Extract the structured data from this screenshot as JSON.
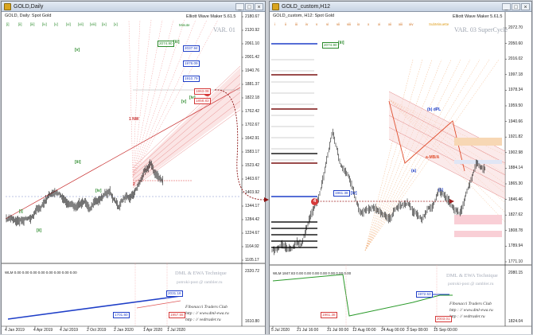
{
  "left": {
    "title": "GOLD,Daily",
    "symbol_line": "GOLD, Daily:  Spot Gold",
    "ewm": "Elliott Wave Maker 5.61.5",
    "var": "VAR. 01",
    "minute": "Minute",
    "price_labels": [
      "2180.67",
      "2120.92",
      "2061.10",
      "2001.42",
      "1940.76",
      "1881.37",
      "1822.18",
      "1762.42",
      "1702.67",
      "1642.91",
      "1583.17",
      "1523.42",
      "1463.67",
      "1403.92",
      "1344.17",
      "1284.42",
      "1224.67",
      "1164.92",
      "1105.17"
    ],
    "ind_labels": [
      "2320.72",
      "1610.80"
    ],
    "date_labels": [
      "4 Jan 2019",
      "4 Apr 2019",
      "4 Jul 2019",
      "2 Oct 2019",
      "2 Jan 2020",
      "1 Apr 2020",
      "1 Jul 2020"
    ],
    "boxes": [
      "2074.90",
      "2037.94",
      "1976.09",
      "1910.79",
      "1863.08",
      "1858.83"
    ],
    "wave_labels": [
      "[i]",
      "[ii]",
      "[iii]",
      "[iv]",
      "[v]",
      "[iii]",
      "[iv]",
      "[v]",
      "1 NW",
      "2"
    ],
    "indicator_label": "WLM 0.00 0.00 0.00 0.00 0.00 0.00 0.00 0.00",
    "ind_boxes": [
      "1701.60",
      "2031.18",
      "1957.55"
    ],
    "technique": "DML & EWA Technique",
    "technique2": "potroki-post @ rambler.ru",
    "site": "Fibonacci   Traders   Club",
    "site2": "http : // www.dml-ewa.ru",
    "site3": "http : // vedtrader.ru",
    "marker": "4",
    "top_tags": [
      "[i]",
      "[ii]",
      "[iii]",
      "[iv]",
      "[v]",
      "[vi]",
      "[vii]",
      "[viii]",
      "[ix]",
      "[x]"
    ]
  },
  "right": {
    "title": "GOLD_custom,H12",
    "symbol_line": "GOLD_custom, H12:  Spot Gold",
    "ewm": "Elliott Wave Maker 5.61.5",
    "var": "VAR. 03 SuperCycle",
    "submin": "SubMinuette",
    "price_labels": [
      "2072.70",
      "2050.60",
      "2016.02",
      "1997.18",
      "1978.34",
      "1959.50",
      "1940.66",
      "1921.82",
      "1902.98",
      "1884.14",
      "1865.30",
      "1846.46",
      "1827.62",
      "1808.78",
      "1789.94",
      "1771.10"
    ],
    "ind_labels": [
      "2080.15",
      "1824.04"
    ],
    "date_labels": [
      "5 Jul 2020",
      "21 Jul 16:00",
      "31 Jul 00:00",
      "12 Aug 00:00",
      "24 Aug 00:00",
      "3 Sep 08:00",
      "15 Sep 00:00"
    ],
    "boxes": [
      "2074.90",
      "1961.38"
    ],
    "wave_labels": [
      "[iii]",
      "[iv]",
      "(b) dPL",
      "(a)",
      "(c)",
      "a-MB/A"
    ],
    "indicator_label": "WLM 1847.83 0.00 0.00 0.00 0.00 0.00 0.00 0.00",
    "ind_boxes": [
      "1972.53",
      "1961.38",
      "2003.01"
    ],
    "technique": "DML & EWA Technique",
    "technique2": "potroki-post @ rambler.ru",
    "site": "Fibonacci   Traders   Club",
    "site2": "http : // www.dml-ewa.ru",
    "site3": "http : // vedtrader.ru",
    "marker": "4",
    "top_tags": [
      "i",
      "ii",
      "iii",
      "iv",
      "v",
      "vi",
      "vii",
      "viii",
      "ix",
      "x",
      "xi",
      "xii",
      "xiii",
      "xiv"
    ]
  },
  "window_buttons": {
    "minimize": "_",
    "maximize": "□",
    "close": "×"
  },
  "colors": {
    "bull": "#000000",
    "channel": "#e05a5a",
    "fib": "#f3a0a0",
    "ind_line": "#1f3fc8",
    "ind_line2": "#2a9a2a",
    "marker": "#d63a3a",
    "grey": "#9da4b0"
  }
}
